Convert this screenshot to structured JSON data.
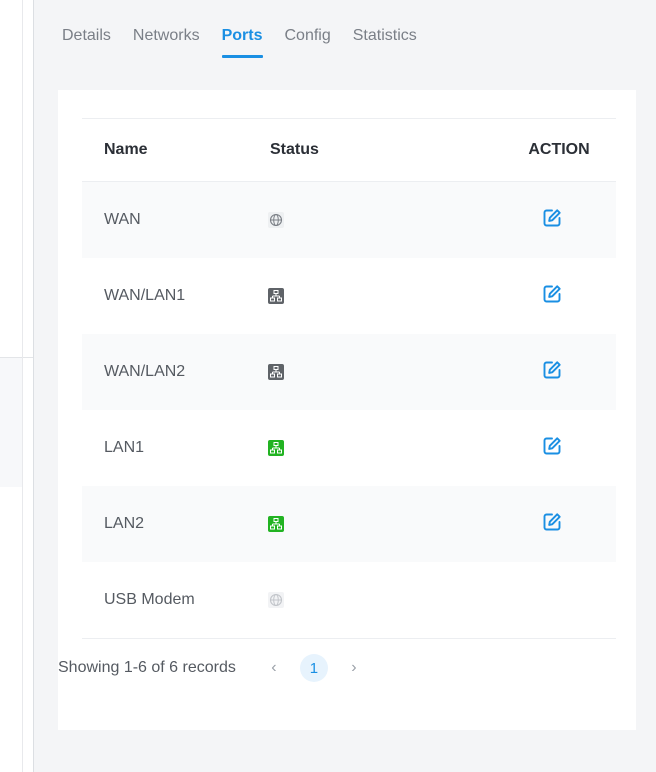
{
  "tabs": [
    {
      "label": "Details"
    },
    {
      "label": "Networks"
    },
    {
      "label": "Ports"
    },
    {
      "label": "Config"
    },
    {
      "label": "Statistics"
    }
  ],
  "active_tab": "Ports",
  "table": {
    "headers": {
      "name": "Name",
      "status": "Status",
      "action": "ACTION"
    },
    "rows": [
      {
        "name": "WAN",
        "status_icon": "globe-icon",
        "status_color": "#7b7f86",
        "editable": true
      },
      {
        "name": "WAN/LAN1",
        "status_icon": "network-port-icon",
        "status_color": "#5f6368",
        "editable": true
      },
      {
        "name": "WAN/LAN2",
        "status_icon": "network-port-icon",
        "status_color": "#5f6368",
        "editable": true
      },
      {
        "name": "LAN1",
        "status_icon": "network-port-icon",
        "status_color": "#22b322",
        "editable": true
      },
      {
        "name": "LAN2",
        "status_icon": "network-port-icon",
        "status_color": "#22b322",
        "editable": true
      },
      {
        "name": "USB Modem",
        "status_icon": "globe-icon",
        "status_color": "#c2c5ca",
        "editable": false
      }
    ]
  },
  "footer": {
    "summary": "Showing 1-6 of 6 records",
    "prev": "‹",
    "current_page": "1",
    "next": "›"
  },
  "colors": {
    "accent": "#1a8fe3",
    "online": "#22b322",
    "offline": "#5f6368"
  }
}
